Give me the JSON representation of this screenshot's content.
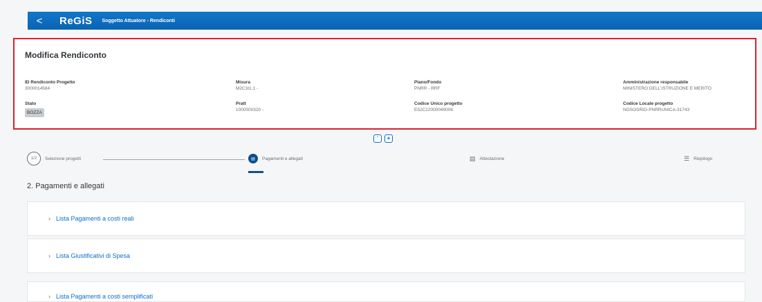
{
  "shellbar": {
    "back": "<",
    "logo": "ReGiS",
    "title": "Soggetto Attuatore - Rendiconti"
  },
  "header": {
    "title": "Modifica Rendiconto",
    "attributes": [
      {
        "label": "ID Rendiconto Progetto",
        "value": "3000014584"
      },
      {
        "label": "Misura",
        "value": "M2C3I1.1 -"
      },
      {
        "label": "Piano/Fondo",
        "value": "PNRR - RRF"
      },
      {
        "label": "Amministrazione responsabile",
        "value": "MINISTERO DELL'ISTRUZIONE E MERITO"
      },
      {
        "label": "Stato",
        "value": "BOZZA"
      },
      {
        "label": "Pratt",
        "value": "1000000320 -"
      },
      {
        "label": "Codice Unico progetto",
        "value": "E52C22000040006"
      },
      {
        "label": "Codice Locale progetto",
        "value": "NGSOSRIG-PNRRUNICA-31743"
      }
    ]
  },
  "toggles": {
    "collapse_icon": "collapse-icon",
    "pin_icon": "pin-icon"
  },
  "steps": [
    {
      "label": "Selezione progetti",
      "icon_text": "1/2"
    },
    {
      "label": "Pagamenti e allegati",
      "icon_text": "▤"
    },
    {
      "label": "Attestazione",
      "icon": "document-icon"
    },
    {
      "label": "Riepilogo",
      "icon": "list-icon"
    }
  ],
  "section_title": "2. Pagamenti e allegati",
  "panels": [
    {
      "title": "Lista Pagamenti a costi reali"
    },
    {
      "title": "Lista Giustificativi di Spesa"
    },
    {
      "title": "Lista Pagamenti a costi semplificati"
    }
  ],
  "colors": {
    "shellbar": "#0a6ed1",
    "highlight_border": "#d9202d",
    "link": "#0a6ed1",
    "active_step": "#0a4f91"
  }
}
